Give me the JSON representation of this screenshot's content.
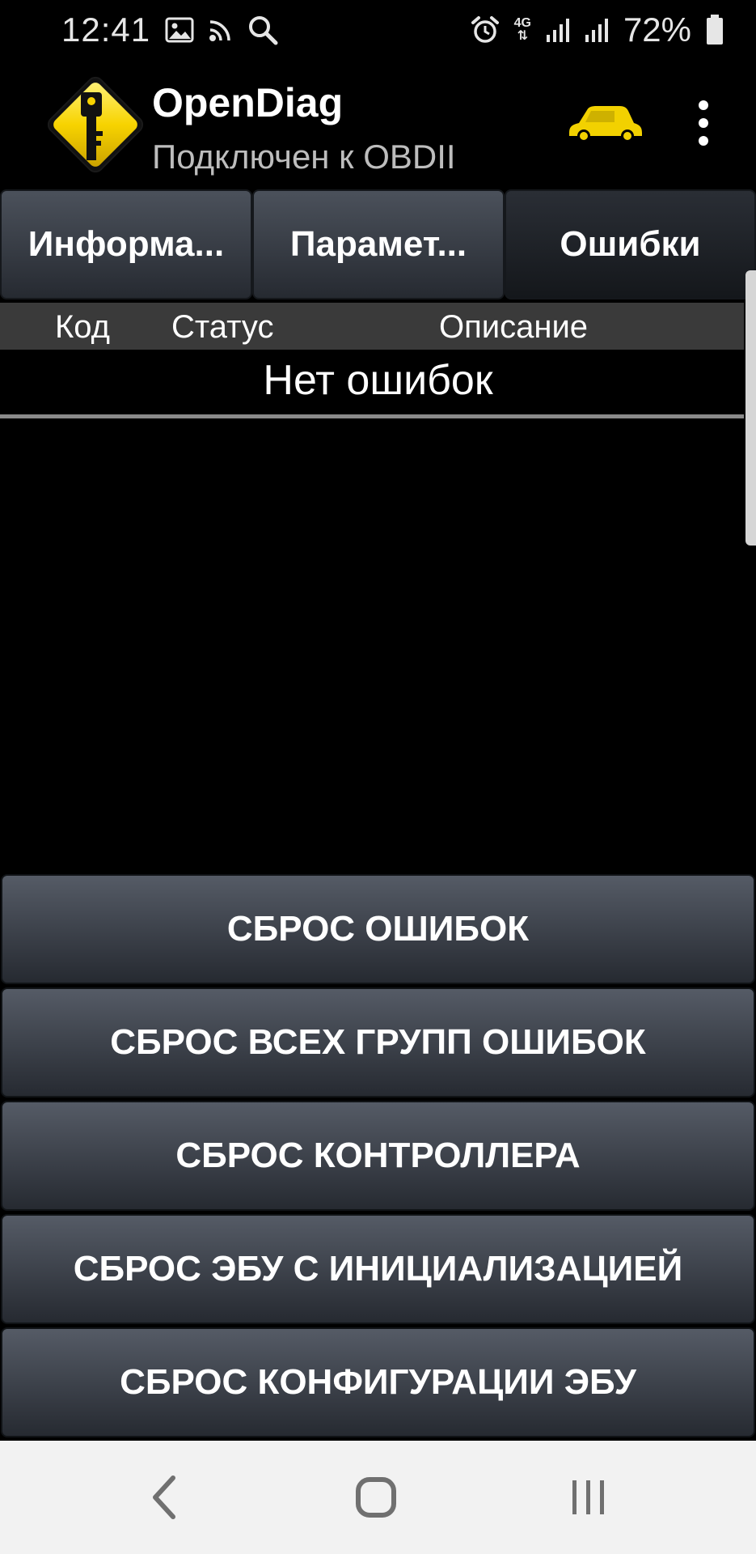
{
  "status_bar": {
    "time": "12:41",
    "network_type": "4G",
    "battery_percent": "72%",
    "icons": [
      "image-icon",
      "cast-icon",
      "search-icon",
      "alarm-icon",
      "signal-icon",
      "signal-icon",
      "battery-icon"
    ]
  },
  "app_bar": {
    "title": "OpenDiag",
    "subtitle": "Подключен к OBDII",
    "car_icon_color": "#f2d100",
    "logo_color": "#f7d300"
  },
  "tabs": [
    {
      "label": "Информа...",
      "selected": false
    },
    {
      "label": "Парамет...",
      "selected": false
    },
    {
      "label": "Ошибки",
      "selected": true
    }
  ],
  "table": {
    "columns": [
      "Код",
      "Статус",
      "Описание"
    ],
    "empty_message": "Нет ошибок"
  },
  "actions": [
    {
      "label": "СБРОС ОШИБОК"
    },
    {
      "label": "СБРОС ВСЕХ ГРУПП ОШИБОК"
    },
    {
      "label": "СБРОС КОНТРОЛЛЕРА"
    },
    {
      "label": "СБРОС ЭБУ С ИНИЦИАЛИЗАЦИЕЙ"
    },
    {
      "label": "СБРОС КОНФИГУРАЦИИ ЭБУ"
    }
  ],
  "nav_bar": {
    "buttons": [
      "back-icon",
      "home-icon",
      "recent-apps-icon"
    ]
  }
}
